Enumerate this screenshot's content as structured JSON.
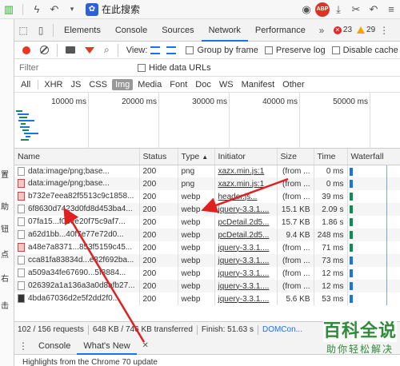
{
  "browser_bar": {
    "search_label": "在此搜索",
    "abp_label": "ABP"
  },
  "devtools": {
    "tabs": [
      "Elements",
      "Console",
      "Sources",
      "Network",
      "Performance"
    ],
    "active_tab": "Network",
    "errors": "23",
    "warnings": "29",
    "toolbar": {
      "view_label": "View:",
      "group_by_frame": "Group by frame",
      "preserve_log": "Preserve log",
      "disable_cache": "Disable cache"
    },
    "filter": {
      "placeholder": "Filter",
      "hide_data_urls": "Hide data URLs"
    },
    "types": [
      "All",
      "XHR",
      "JS",
      "CSS",
      "Img",
      "Media",
      "Font",
      "Doc",
      "WS",
      "Manifest",
      "Other"
    ],
    "active_type": "Img",
    "overview_ticks": [
      "10000 ms",
      "20000 ms",
      "30000 ms",
      "40000 ms",
      "50000 ms"
    ],
    "columns": {
      "name": "Name",
      "status": "Status",
      "type": "Type",
      "initiator": "Initiator",
      "size": "Size",
      "time": "Time",
      "waterfall": "Waterfall"
    },
    "rows": [
      {
        "name": "data:image/png;base...",
        "status": "200",
        "type": "png",
        "initiator": "xazx.min.js:1",
        "size": "(from ...",
        "time": "0 ms",
        "icon": "plain",
        "wf_color": "#1a73e8"
      },
      {
        "name": "data:image/png;base...",
        "status": "200",
        "type": "png",
        "initiator": "xazx.min.js:1",
        "size": "(from ...",
        "time": "0 ms",
        "icon": "img",
        "wf_color": "#1a73e8"
      },
      {
        "name": "b732e7eea82f5513c9c1858...",
        "status": "200",
        "type": "webp",
        "initiator": "header.js...",
        "size": "(from ...",
        "time": "39 ms",
        "icon": "img",
        "wf_color": "#0a8f50"
      },
      {
        "name": "6f8630d7423d0fd8d453ba4...",
        "status": "200",
        "type": "webp",
        "initiator": "jquery-3.3.1....",
        "size": "15.1 KB",
        "time": "2.09 s",
        "icon": "plain",
        "wf_color": "#0a8f50"
      },
      {
        "name": "07fa15...f06ee20f75c9af7...",
        "status": "200",
        "type": "webp",
        "initiator": "pcDetail.2d5...",
        "size": "15.7 KB",
        "time": "1.86 s",
        "icon": "plain",
        "wf_color": "#0a8f50"
      },
      {
        "name": "a62d1bb...40f7e77e72d0...",
        "status": "200",
        "type": "webp",
        "initiator": "pcDetail.2d5...",
        "size": "9.4 KB",
        "time": "248 ms",
        "icon": "plain",
        "wf_color": "#0a8f50"
      },
      {
        "name": "a48e7a8371...853f5159c45...",
        "status": "200",
        "type": "webp",
        "initiator": "jquery-3.3.1....",
        "size": "(from ...",
        "time": "71 ms",
        "icon": "img",
        "wf_color": "#0a8f50"
      },
      {
        "name": "cca81fa83834d...e82f692ba...",
        "status": "200",
        "type": "webp",
        "initiator": "jquery-3.3.1....",
        "size": "(from ...",
        "time": "73 ms",
        "icon": "plain",
        "wf_color": "#1a73e8"
      },
      {
        "name": "a509a34fe67690...5f3884...",
        "status": "200",
        "type": "webp",
        "initiator": "jquery-3.3.1....",
        "size": "(from ...",
        "time": "12 ms",
        "icon": "plain",
        "wf_color": "#1a73e8"
      },
      {
        "name": "026392a1a136a3a0d8afb27...",
        "status": "200",
        "type": "webp",
        "initiator": "jquery-3.3.1....",
        "size": "(from ...",
        "time": "12 ms",
        "icon": "plain",
        "wf_color": "#1a73e8"
      },
      {
        "name": "4bda67036d2e5f2dd2f0...",
        "status": "200",
        "type": "webp",
        "initiator": "jquery-3.3.1....",
        "size": "5.6 KB",
        "time": "53 ms",
        "icon": "dark",
        "wf_color": "#1a73e8"
      }
    ],
    "status_bar": {
      "requests": "102 / 156 requests",
      "transferred": "648 KB / 746 KB transferred",
      "finish": "Finish: 51.63 s",
      "dom": "DOMCon..."
    },
    "drawer": {
      "tabs": [
        "Console",
        "What's New"
      ],
      "active_tab": "What's New",
      "body": "Highlights from the Chrome 70 update"
    }
  },
  "watermark": {
    "title": "百科全说",
    "subtitle": "助你轻松解决"
  },
  "colors": {
    "accent": "#1a73e8",
    "record": "#e33333",
    "arrow": "#e02020",
    "watermark": "#2f8a3c"
  }
}
